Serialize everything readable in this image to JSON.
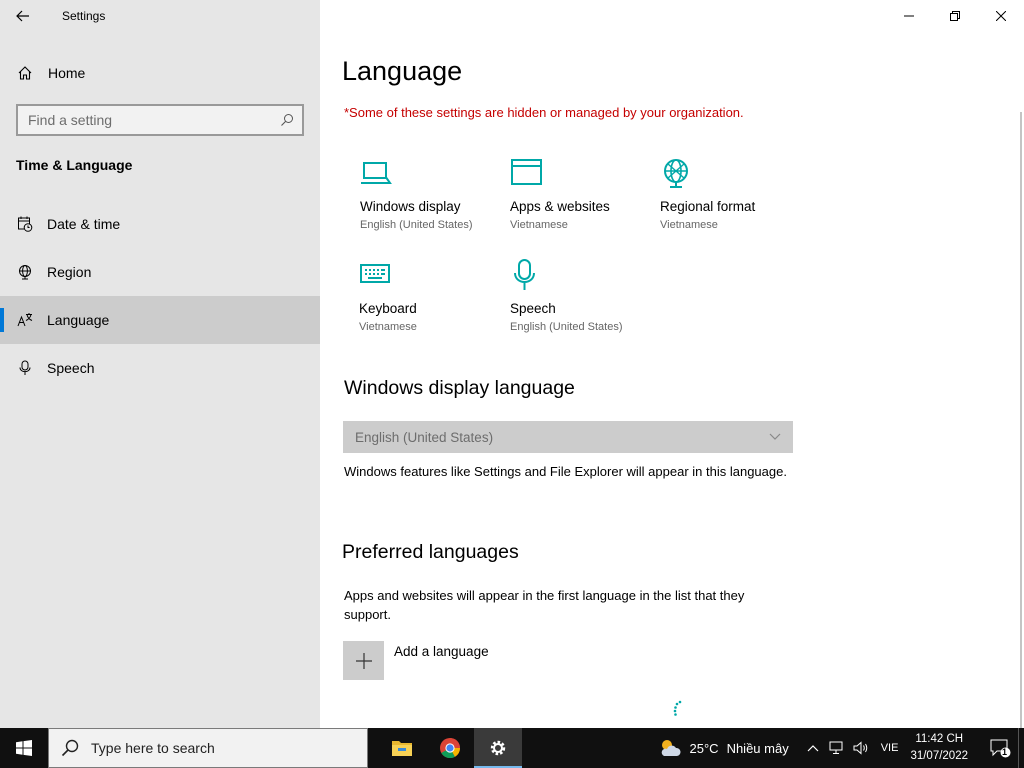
{
  "app": {
    "title": "Settings"
  },
  "sidebar": {
    "home_label": "Home",
    "search_placeholder": "Find a setting",
    "section_title": "Time & Language",
    "items": [
      {
        "label": "Date & time",
        "icon": "date-time-icon"
      },
      {
        "label": "Region",
        "icon": "globe-icon"
      },
      {
        "label": "Language",
        "icon": "language-icon",
        "active": true
      },
      {
        "label": "Speech",
        "icon": "microphone-icon"
      }
    ]
  },
  "main": {
    "title": "Language",
    "warning": "*Some of these settings are hidden or managed by your organization.",
    "tiles": [
      {
        "label": "Windows display",
        "sub": "English (United States)",
        "icon": "laptop-icon"
      },
      {
        "label": "Apps & websites",
        "sub": "Vietnamese",
        "icon": "window-icon"
      },
      {
        "label": "Regional format",
        "sub": "Vietnamese",
        "icon": "globe-icon"
      },
      {
        "label": "Keyboard",
        "sub": "Vietnamese",
        "icon": "keyboard-icon"
      },
      {
        "label": "Speech",
        "sub": "English (United States)",
        "icon": "microphone-icon"
      }
    ],
    "display_language": {
      "heading": "Windows display language",
      "selected": "English (United States)",
      "description": "Windows features like Settings and File Explorer will appear in this language."
    },
    "preferred": {
      "heading": "Preferred languages",
      "description": "Apps and websites will appear in the first language in the list that they support.",
      "add_label": "Add a language"
    }
  },
  "taskbar": {
    "search_placeholder": "Type here to search",
    "pinned": [
      "file-explorer-icon",
      "chrome-icon",
      "settings-icon"
    ],
    "weather": {
      "temp": "25°C",
      "desc": "Nhiều mây"
    },
    "language": "VIE",
    "time": "11:42 CH",
    "date": "31/07/2022",
    "notification_count": "1"
  },
  "colors": {
    "accent": "#0078d7",
    "icon_teal": "#00a8a8",
    "warning": "#c50000"
  }
}
